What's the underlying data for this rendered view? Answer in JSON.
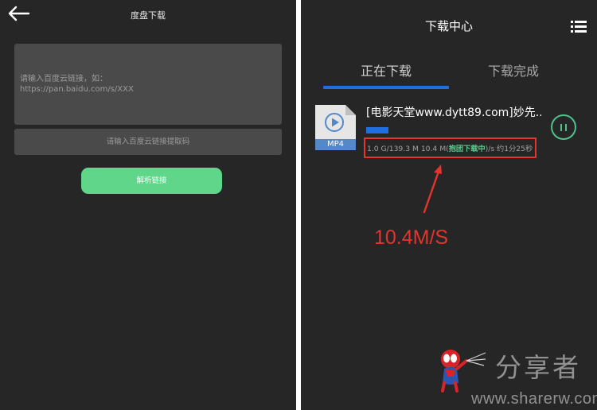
{
  "left_screen": {
    "title": "度盘下载",
    "link_input": {
      "placeholder_line1": "请输入百度云链接，如：",
      "placeholder_line2": "https://pan.baidu.com/s/XXX"
    },
    "code_input": {
      "placeholder": "请输入百度云链接提取码"
    },
    "parse_button": "解析链接"
  },
  "right_screen": {
    "title": "下载中心",
    "tabs": [
      {
        "label": "正在下载",
        "active": true
      },
      {
        "label": "下载完成",
        "active": false
      }
    ],
    "download_item": {
      "file_type": "MP4",
      "file_name": "[电影天堂www.dytt89.com]妙先...",
      "progress_fraction": 0.0072,
      "stats": {
        "size_text": "1.0 G/139.3 M 10.4 M(",
        "badge": "抱团下载中",
        "rate_text": ")/s 约1分25秒"
      }
    },
    "annotation": {
      "text": "10.4M/S",
      "color": "#e3342d"
    },
    "watermark": {
      "name": "分享者",
      "url": "www.sharerw.com"
    }
  },
  "colors": {
    "accent_blue": "#1f6fe0",
    "accent_green": "#5fd68a",
    "annotation_red": "#e3342d",
    "background": "#262626"
  }
}
